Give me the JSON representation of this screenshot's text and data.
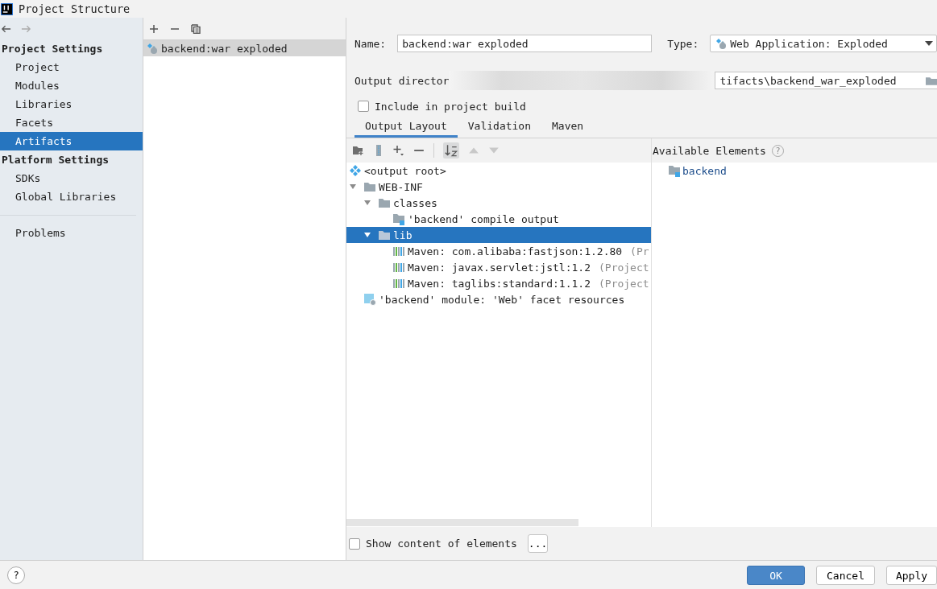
{
  "window": {
    "title": "Project Structure"
  },
  "sidebar": {
    "sections": [
      {
        "heading": "Project Settings",
        "items": [
          {
            "label": "Project",
            "selected": false
          },
          {
            "label": "Modules",
            "selected": false
          },
          {
            "label": "Libraries",
            "selected": false
          },
          {
            "label": "Facets",
            "selected": false
          },
          {
            "label": "Artifacts",
            "selected": true
          }
        ]
      },
      {
        "heading": "Platform Settings",
        "items": [
          {
            "label": "SDKs",
            "selected": false
          },
          {
            "label": "Global Libraries",
            "selected": false
          }
        ]
      }
    ],
    "footer_items": [
      {
        "label": "Problems",
        "selected": false
      }
    ]
  },
  "artifacts": [
    {
      "label": "backend:war exploded",
      "selected": true
    }
  ],
  "form": {
    "name_label": "Name:",
    "name_value": "backend:war exploded",
    "type_label": "Type:",
    "type_value": "Web Application: Exploded",
    "output_label": "Output director",
    "output_value": "tifacts\\backend_war_exploded",
    "include_label": "Include in project build",
    "include_checked": false
  },
  "tabs": [
    {
      "label": "Output Layout",
      "selected": true
    },
    {
      "label": "Validation",
      "selected": false
    },
    {
      "label": "Maven",
      "selected": false
    }
  ],
  "layout_tree": {
    "kind": "root",
    "label": "<output root>",
    "selected": false,
    "children": [
      {
        "kind": "folder",
        "label": "WEB-INF",
        "expanded": true,
        "selected": false,
        "children": [
          {
            "kind": "folder",
            "label": "classes",
            "expanded": true,
            "selected": false,
            "children": [
              {
                "kind": "compile",
                "label": "'backend' compile output",
                "selected": false
              }
            ]
          },
          {
            "kind": "folder",
            "label": "lib",
            "expanded": true,
            "selected": true,
            "children": [
              {
                "kind": "library",
                "label": "Maven: com.alibaba:fastjson:1.2.80",
                "suffix": "(Pr",
                "selected": false
              },
              {
                "kind": "library",
                "label": "Maven: javax.servlet:jstl:1.2",
                "suffix": "(Project",
                "selected": false
              },
              {
                "kind": "library",
                "label": "Maven: taglibs:standard:1.1.2",
                "suffix": "(Project",
                "selected": false
              }
            ]
          }
        ]
      },
      {
        "kind": "facet",
        "label": "'backend' module: 'Web' facet resources",
        "selected": false
      }
    ]
  },
  "available": {
    "title": "Available Elements",
    "help": "?",
    "items": [
      {
        "label": "backend"
      }
    ]
  },
  "show_content": {
    "label": "Show content of elements",
    "checked": false,
    "button": "..."
  },
  "help_button": "?",
  "buttons": [
    {
      "label": "OK",
      "kind": "primary"
    },
    {
      "label": "Cancel",
      "kind": "normal"
    },
    {
      "label": "Apply",
      "kind": "normal"
    }
  ]
}
